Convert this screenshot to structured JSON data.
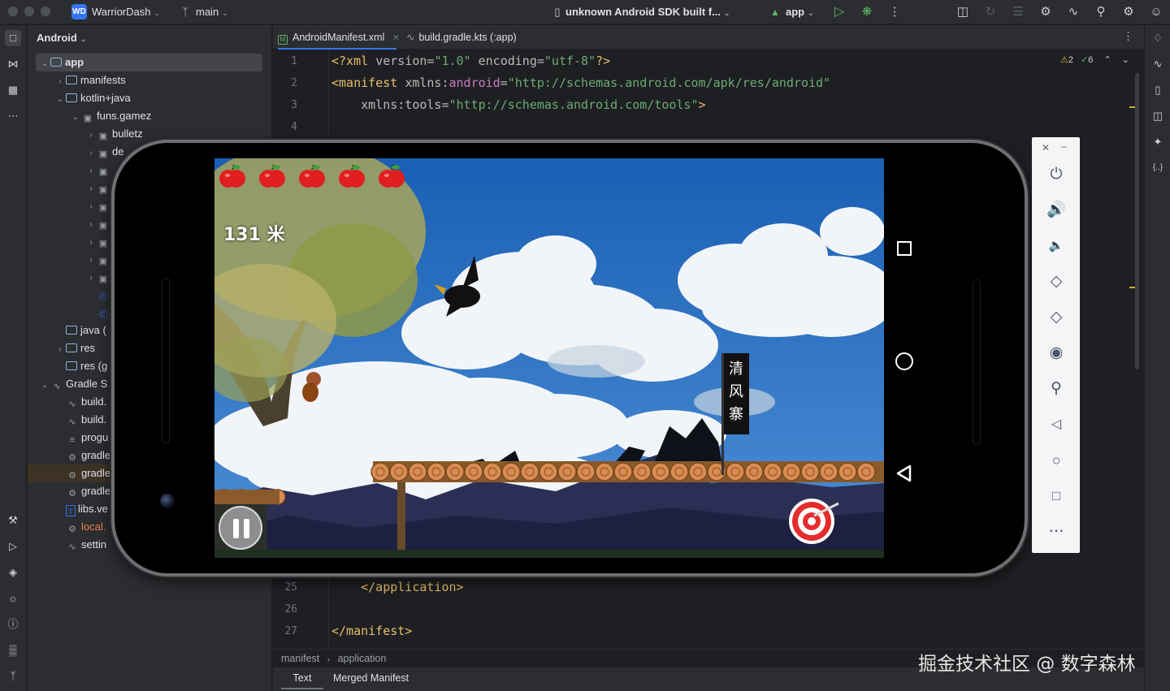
{
  "titlebar": {
    "project_badge": "WD",
    "project_name": "WarriorDash",
    "branch": "main",
    "device": "unknown Android SDK built f...",
    "run_config": "app"
  },
  "project_panel": {
    "view": "Android",
    "tree": [
      {
        "label": "app",
        "level": 0,
        "arrow": "open",
        "icon": "module",
        "selected": true
      },
      {
        "label": "manifests",
        "level": 1,
        "arrow": "closed",
        "icon": "folder"
      },
      {
        "label": "kotlin+java",
        "level": 1,
        "arrow": "open",
        "icon": "folder"
      },
      {
        "label": "funs.gamez",
        "level": 2,
        "arrow": "open",
        "icon": "package"
      },
      {
        "label": "bulletz",
        "level": 3,
        "arrow": "closed",
        "icon": "package"
      },
      {
        "label": "de",
        "level": 3,
        "arrow": "closed",
        "icon": "package"
      },
      {
        "label": "",
        "level": 3,
        "arrow": "closed",
        "icon": "package"
      },
      {
        "label": "",
        "level": 3,
        "arrow": "closed",
        "icon": "package"
      },
      {
        "label": "",
        "level": 3,
        "arrow": "closed",
        "icon": "package"
      },
      {
        "label": "",
        "level": 3,
        "arrow": "closed",
        "icon": "package"
      },
      {
        "label": "",
        "level": 3,
        "arrow": "closed",
        "icon": "package"
      },
      {
        "label": "",
        "level": 3,
        "arrow": "closed",
        "icon": "package"
      },
      {
        "label": "",
        "level": 3,
        "arrow": "closed",
        "icon": "package"
      },
      {
        "label": "",
        "level": 3,
        "arrow": "none",
        "icon": "class"
      },
      {
        "label": "",
        "level": 3,
        "arrow": "none",
        "icon": "class"
      },
      {
        "label": "java (",
        "level": 1,
        "arrow": "none",
        "icon": "folder"
      },
      {
        "label": "res",
        "level": 1,
        "arrow": "closed",
        "icon": "folder"
      },
      {
        "label": "res (g",
        "level": 1,
        "arrow": "none",
        "icon": "folder"
      },
      {
        "label": "Gradle S",
        "level": 0,
        "arrow": "open",
        "icon": "gradle"
      },
      {
        "label": "build.",
        "level": 1,
        "arrow": "none",
        "icon": "gradle"
      },
      {
        "label": "build.",
        "level": 1,
        "arrow": "none",
        "icon": "gradle"
      },
      {
        "label": "progu",
        "level": 1,
        "arrow": "none",
        "icon": "text"
      },
      {
        "label": "gradle",
        "level": 1,
        "arrow": "none",
        "icon": "gear"
      },
      {
        "label": "gradle",
        "level": 1,
        "arrow": "none",
        "icon": "gear",
        "highlight": true
      },
      {
        "label": "gradle",
        "level": 1,
        "arrow": "none",
        "icon": "gear"
      },
      {
        "label": "libs.ve",
        "level": 1,
        "arrow": "none",
        "icon": "toml"
      },
      {
        "label": "local.",
        "level": 1,
        "arrow": "none",
        "icon": "gear",
        "orange": true
      },
      {
        "label": "settin",
        "level": 1,
        "arrow": "none",
        "icon": "gradle"
      }
    ]
  },
  "editor": {
    "tabs": [
      {
        "label": "AndroidManifest.xml",
        "active": true
      },
      {
        "label": "build.gradle.kts (:app)",
        "active": false
      }
    ],
    "inspections": {
      "warnings": "2",
      "ok": "6"
    },
    "line_numbers": [
      "1",
      "2",
      "3",
      "4",
      "25",
      "26",
      "27"
    ],
    "code": {
      "l1_decl": "<?xml ",
      "l1_attr1": "version=",
      "l1_val1": "\"1.0\"",
      "l1_attr2": " encoding=",
      "l1_val2": "\"utf-8\"",
      "l1_end": "?>",
      "l2_tag": "<manifest ",
      "l2_attr": "xmlns:",
      "l2_ns": "android",
      "l2_eq": "=",
      "l2_val": "\"http://schemas.android.com/apk/res/android\"",
      "l3_attr": "    xmlns:tools=",
      "l3_val": "\"http://schemas.android.com/tools\"",
      "l3_end": ">",
      "l25": "    </application>",
      "l27": "</manifest>"
    },
    "breadcrumb": [
      "manifest",
      "application"
    ],
    "bottom_tabs": [
      "Text",
      "Merged Manifest"
    ]
  },
  "game": {
    "lives": 5,
    "distance": "131 米",
    "sign_text": [
      "清",
      "风",
      "寨"
    ]
  },
  "watermark": "掘金技术社区 @ 数字森林",
  "icons": {
    "emulator_toolbar": [
      "close-icon",
      "minimize-icon",
      "power-icon",
      "volume-up-icon",
      "volume-down-icon",
      "rotate-left-icon",
      "rotate-right-icon",
      "camera-icon",
      "zoom-icon",
      "back-icon",
      "home-icon",
      "overview-icon",
      "more-icon"
    ]
  }
}
